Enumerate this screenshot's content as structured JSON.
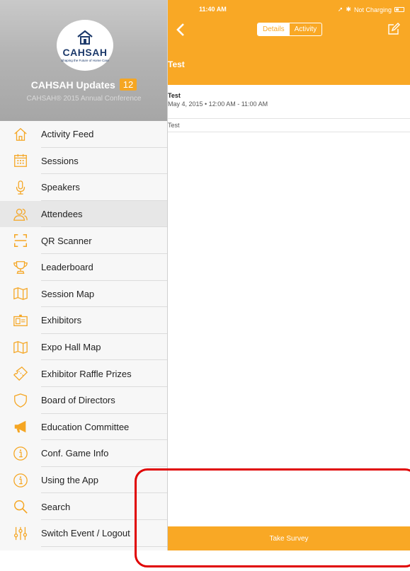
{
  "status": {
    "time": "11:40 AM",
    "charging": "Not Charging"
  },
  "sidebar": {
    "logo_text": "CAHSAH",
    "logo_tag": "Shaping the Future of Home Care",
    "updates_title": "CAHSAH Updates",
    "updates_count": "12",
    "conference": "CAHSAH® 2015 Annual Conference",
    "items": [
      {
        "label": "Activity Feed",
        "icon": "home-icon"
      },
      {
        "label": "Sessions",
        "icon": "calendar-icon"
      },
      {
        "label": "Speakers",
        "icon": "microphone-icon"
      },
      {
        "label": "Attendees",
        "icon": "people-icon"
      },
      {
        "label": "QR Scanner",
        "icon": "qr-scan-icon"
      },
      {
        "label": "Leaderboard",
        "icon": "trophy-icon"
      },
      {
        "label": "Session Map",
        "icon": "map-icon"
      },
      {
        "label": "Exhibitors",
        "icon": "badge-icon"
      },
      {
        "label": "Expo Hall Map",
        "icon": "map-icon"
      },
      {
        "label": "Exhibitor Raffle Prizes",
        "icon": "ticket-icon"
      },
      {
        "label": "Board of Directors",
        "icon": "shield-icon"
      },
      {
        "label": "Education Committee",
        "icon": "megaphone-icon"
      },
      {
        "label": "Conf. Game Info",
        "icon": "info-icon"
      },
      {
        "label": "Using the App",
        "icon": "info-icon"
      },
      {
        "label": "Search",
        "icon": "search-icon"
      },
      {
        "label": "Switch Event / Logout",
        "icon": "sliders-icon"
      }
    ]
  },
  "header": {
    "tabs": [
      {
        "label": "Details"
      },
      {
        "label": "Activity"
      }
    ],
    "title": "Test"
  },
  "event": {
    "name": "Test",
    "date": "May 4, 2015 • 12:00 AM - 11:00 AM",
    "description": "Test"
  },
  "survey_label": "Take Survey",
  "colors": {
    "accent": "#f9a825",
    "highlight": "#e00000"
  }
}
